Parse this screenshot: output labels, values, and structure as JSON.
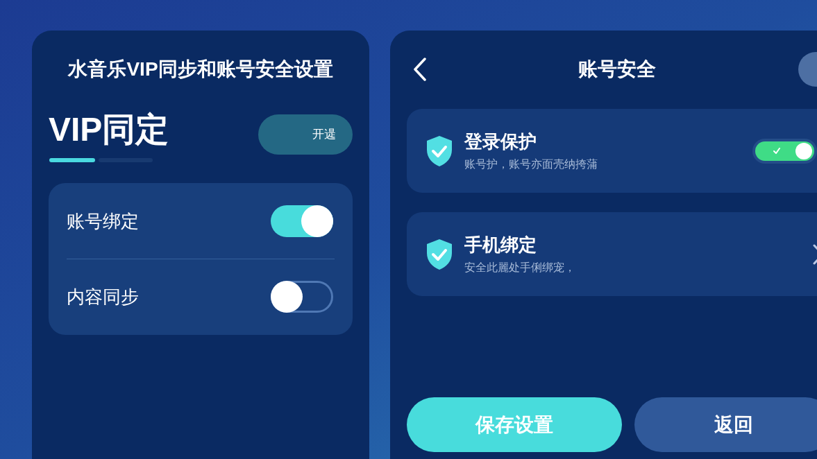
{
  "left_panel": {
    "title": "水音乐VIP同步和账号安全设置",
    "heading": "VIP同定",
    "action_button": "开遈",
    "page_indicator": [
      {
        "selected": true
      },
      {
        "selected": false
      }
    ],
    "settings": [
      {
        "label": "账号绑定",
        "on": true
      },
      {
        "label": "内容同步",
        "on": false
      }
    ]
  },
  "right_panel": {
    "title": "账号安全",
    "security_items": [
      {
        "kind": "toggle",
        "title": "登录保护",
        "subtitle": "账号护，账号亦面壳纳挎蒲",
        "on": true
      },
      {
        "kind": "link",
        "title": "手机绑定",
        "subtitle": "安全此麗处手俐绑宠，"
      }
    ],
    "buttons": [
      {
        "kind": "primary",
        "label": "保存设置"
      },
      {
        "kind": "secondary",
        "label": "返回"
      }
    ]
  }
}
